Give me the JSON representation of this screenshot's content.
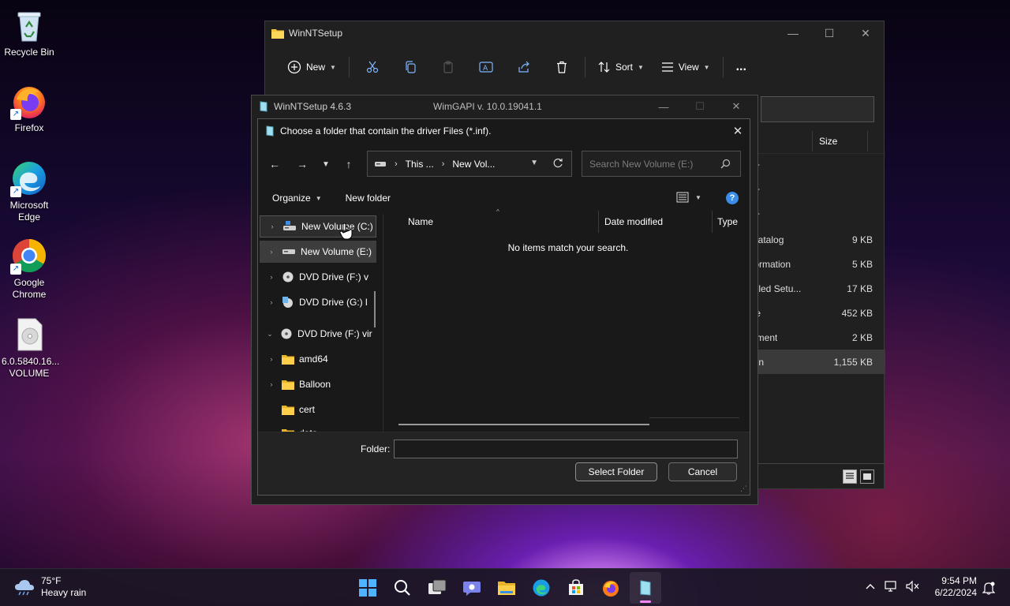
{
  "desktop": {
    "icons": [
      {
        "label": "Recycle Bin"
      },
      {
        "label": "Firefox"
      },
      {
        "label": "Microsoft Edge"
      },
      {
        "label": "Google Chrome"
      },
      {
        "label": "6.0.5840.16... VOLUME"
      }
    ]
  },
  "explorer": {
    "title": "WinNTSetup",
    "toolbar": {
      "new": "New",
      "sort": "Sort",
      "view": "View",
      "more": "..."
    },
    "size_header": "Size",
    "rows": [
      {
        "name": "er",
        "size": ""
      },
      {
        "name": "er",
        "size": ""
      },
      {
        "name": "er",
        "size": ""
      },
      {
        "name": "Catalog",
        "size": "9 KB"
      },
      {
        "name": "formation",
        "size": "5 KB"
      },
      {
        "name": "piled Setu...",
        "size": "17 KB"
      },
      {
        "name": "ile",
        "size": "452 KB"
      },
      {
        "name": "ument",
        "size": "2 KB"
      },
      {
        "name": "ion",
        "size": "1,155 KB"
      }
    ]
  },
  "winnt": {
    "title": "WinNTSetup 4.6.3",
    "version": "WimGAPI v. 10.0.19041.1"
  },
  "dialog": {
    "title": "Choose a folder that contain the driver Files (*.inf).",
    "address": {
      "part1": "This ...",
      "part2": "New Vol..."
    },
    "search_placeholder": "Search New Volume (E:)",
    "organize": "Organize",
    "new_folder": "New folder",
    "help": "?",
    "tree": [
      {
        "label": "New Volume (C:)",
        "icon": "drive"
      },
      {
        "label": "New Volume (E:)",
        "icon": "drive"
      },
      {
        "label": "DVD Drive (F:) v",
        "icon": "dvd"
      },
      {
        "label": "DVD Drive (G:) l",
        "icon": "dvd-setup"
      },
      {
        "label": "DVD Drive (F:) vir",
        "icon": "dvd"
      },
      {
        "label": "amd64",
        "icon": "folder"
      },
      {
        "label": "Balloon",
        "icon": "folder"
      },
      {
        "label": "cert",
        "icon": "folder"
      },
      {
        "label": "data",
        "icon": "folder"
      }
    ],
    "columns": {
      "name": "Name",
      "date": "Date modified",
      "type": "Type"
    },
    "empty_message": "No items match your search.",
    "folder_label": "Folder:",
    "folder_value": "",
    "select_button": "Select Folder",
    "cancel_button": "Cancel"
  },
  "taskbar": {
    "weather": {
      "temp": "75°F",
      "desc": "Heavy rain"
    },
    "clock": {
      "time": "9:54 PM",
      "date": "6/22/2024"
    }
  }
}
